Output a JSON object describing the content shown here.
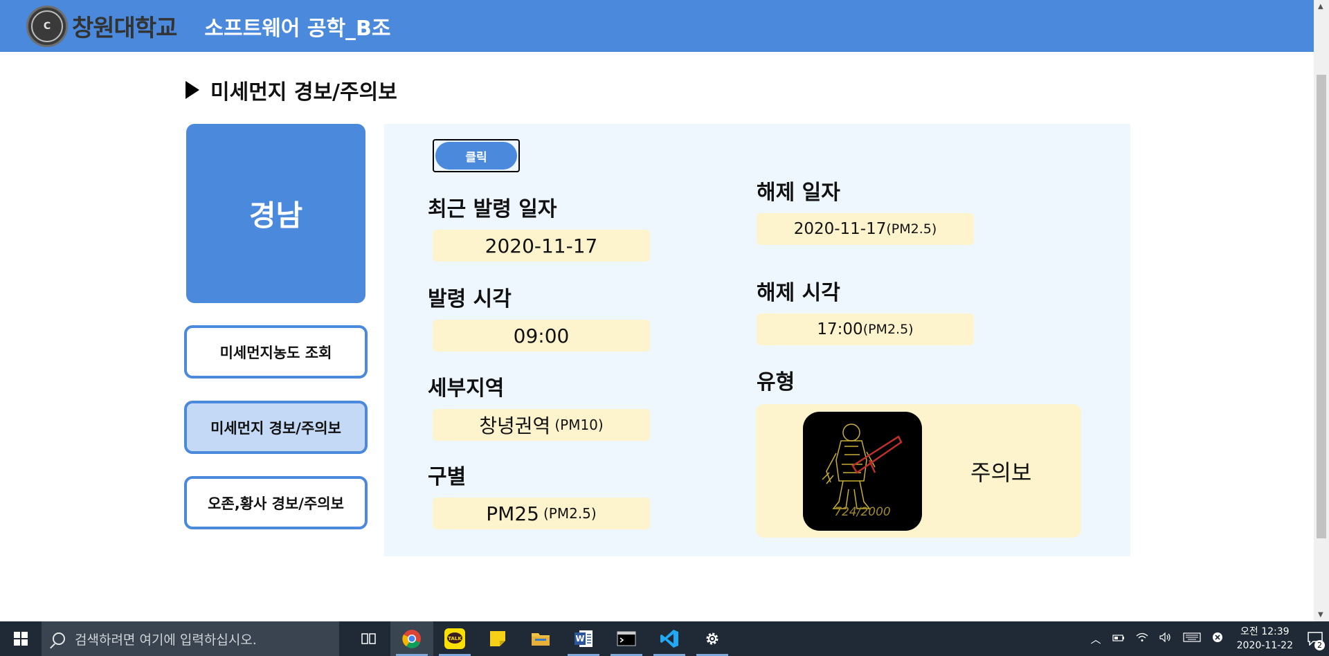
{
  "header": {
    "logo_text": "창원대학교",
    "site_title": "소프트웨어 공학_B조"
  },
  "page": {
    "heading": "미세먼지 경보/주의보"
  },
  "sidebar": {
    "region": "경남",
    "nav": [
      {
        "label": "미세먼지농도 조회",
        "active": false
      },
      {
        "label": "미세먼지 경보/주의보",
        "active": true
      },
      {
        "label": "오존,황사 경보/주의보",
        "active": false
      }
    ]
  },
  "content": {
    "click_button": "클릭",
    "issue_date": {
      "label": "최근 발령 일자",
      "value": "2020-11-17"
    },
    "issue_time": {
      "label": "발령 시각",
      "value": "09:00"
    },
    "sub_region": {
      "label": "세부지역",
      "value": "창녕권역",
      "note": "(PM10)"
    },
    "category": {
      "label": "구별",
      "value": "PM25",
      "note": "(PM2.5)"
    },
    "release_date": {
      "label": "해제 일자",
      "value": "2020-11-17",
      "note": "(PM2.5)"
    },
    "release_time": {
      "label": "해제 시각",
      "value": "17:00",
      "note": "(PM2.5)"
    },
    "type": {
      "label": "유형",
      "value": "주의보",
      "image_caption": "724/2000"
    }
  },
  "taskbar": {
    "search_placeholder": "검색하려면 여기에 입력하십시오.",
    "clock_time": "오전 12:39",
    "clock_date": "2020-11-22",
    "notification_count": "2"
  },
  "colors": {
    "brand": "#4a89dc",
    "panel_bg": "#eef6fe",
    "value_bg": "#fdf3cc",
    "active_nav": "#c4d9f5"
  }
}
